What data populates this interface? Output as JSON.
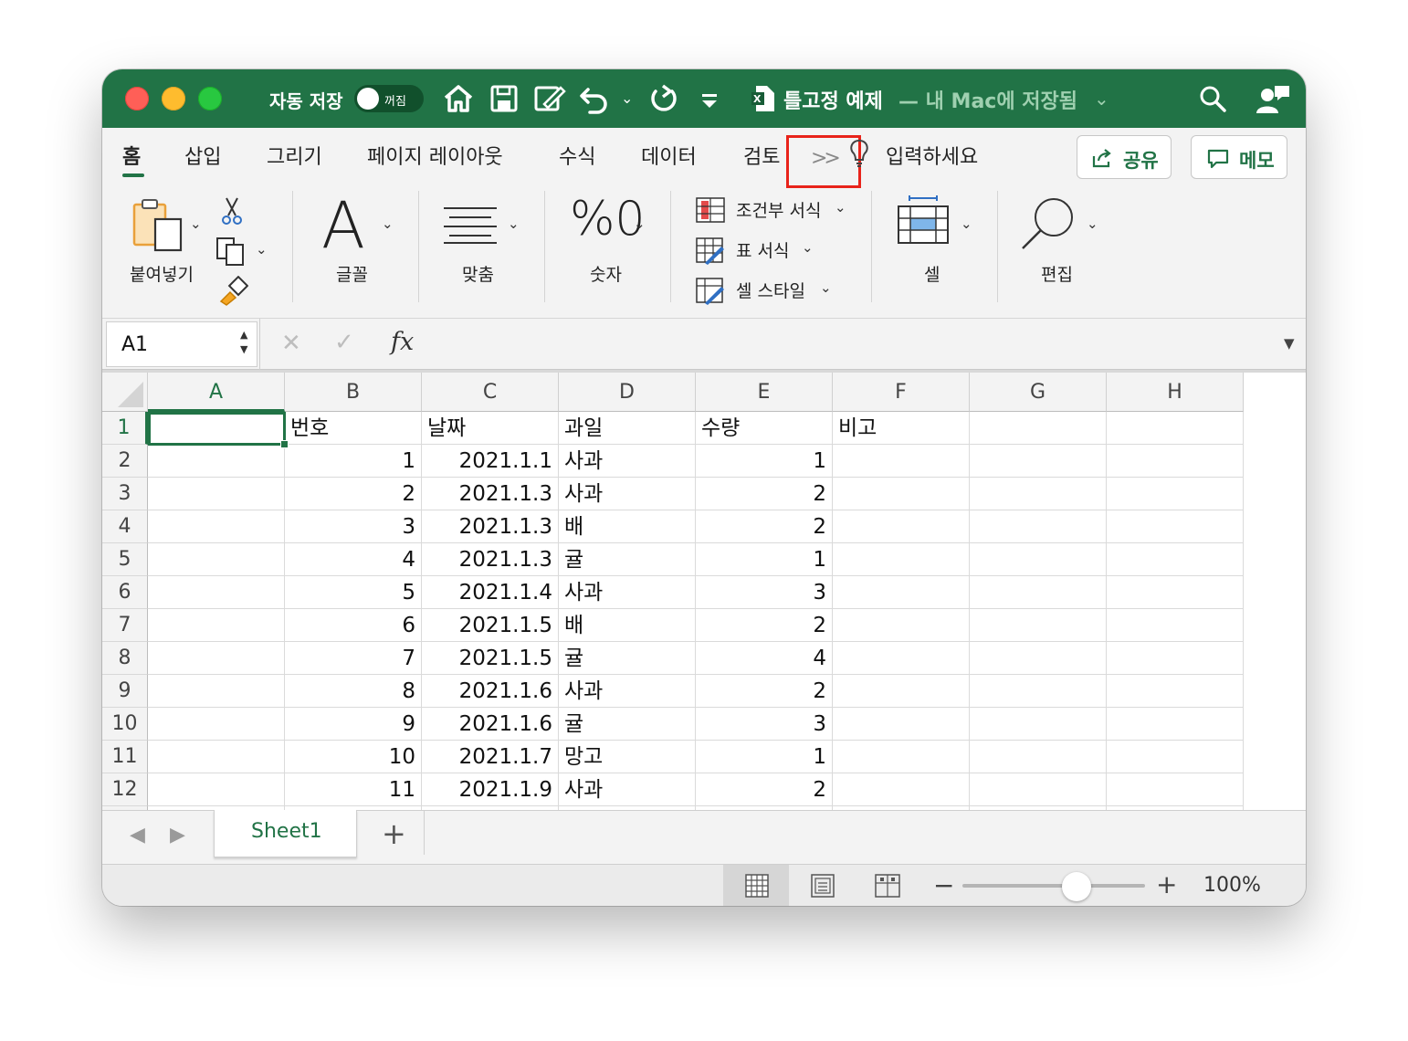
{
  "titlebar": {
    "autosave_label": "자동 저장",
    "autosave_state": "꺼짐",
    "doc_title": "틀고정 예제",
    "doc_location": "— 내 Mac에 저장됨",
    "icons": [
      "home-icon",
      "save-icon",
      "edit-save-icon",
      "undo-icon",
      "redo-icon",
      "customize-icon",
      "excel-doc-icon",
      "search-icon",
      "share-person-icon"
    ]
  },
  "tabs": {
    "items": [
      "홈",
      "삽입",
      "그리기",
      "페이지 레이아웃",
      "수식",
      "데이터",
      "검토"
    ],
    "active": "홈",
    "overflow_label": ">>",
    "tell_me": "입력하세요",
    "share_label": "공유",
    "comments_label": "메모"
  },
  "ribbon": {
    "paste": "붙여넣기",
    "font": "글꼴",
    "alignment": "맞춤",
    "number": "숫자",
    "number_icon": "%0",
    "conditional_format": "조건부 서식",
    "table_format": "표 서식",
    "cell_styles": "셀 스타일",
    "cells": "셀",
    "editing": "편집"
  },
  "formula_bar": {
    "name_box": "A1",
    "fx": "fx",
    "formula": ""
  },
  "sheet": {
    "columns": [
      "A",
      "B",
      "C",
      "D",
      "E",
      "F",
      "G",
      "H"
    ],
    "active_column": "A",
    "active_row": "1",
    "rows": [
      {
        "n": "1",
        "A": "",
        "B": "번호",
        "C": "날짜",
        "D": "과일",
        "E": "수량",
        "F": "비고"
      },
      {
        "n": "2",
        "A": "",
        "B": "1",
        "C": "2021.1.1",
        "D": "사과",
        "E": "1",
        "F": ""
      },
      {
        "n": "3",
        "A": "",
        "B": "2",
        "C": "2021.1.3",
        "D": "사과",
        "E": "2",
        "F": ""
      },
      {
        "n": "4",
        "A": "",
        "B": "3",
        "C": "2021.1.3",
        "D": "배",
        "E": "2",
        "F": ""
      },
      {
        "n": "5",
        "A": "",
        "B": "4",
        "C": "2021.1.3",
        "D": "귤",
        "E": "1",
        "F": ""
      },
      {
        "n": "6",
        "A": "",
        "B": "5",
        "C": "2021.1.4",
        "D": "사과",
        "E": "3",
        "F": ""
      },
      {
        "n": "7",
        "A": "",
        "B": "6",
        "C": "2021.1.5",
        "D": "배",
        "E": "2",
        "F": ""
      },
      {
        "n": "8",
        "A": "",
        "B": "7",
        "C": "2021.1.5",
        "D": "귤",
        "E": "4",
        "F": ""
      },
      {
        "n": "9",
        "A": "",
        "B": "8",
        "C": "2021.1.6",
        "D": "사과",
        "E": "2",
        "F": ""
      },
      {
        "n": "10",
        "A": "",
        "B": "9",
        "C": "2021.1.6",
        "D": "귤",
        "E": "3",
        "F": ""
      },
      {
        "n": "11",
        "A": "",
        "B": "10",
        "C": "2021.1.7",
        "D": "망고",
        "E": "1",
        "F": ""
      },
      {
        "n": "12",
        "A": "",
        "B": "11",
        "C": "2021.1.9",
        "D": "사과",
        "E": "2",
        "F": ""
      }
    ]
  },
  "sheet_tabs": {
    "tabs": [
      "Sheet1"
    ],
    "add_label": "+"
  },
  "status_bar": {
    "zoom_minus": "−",
    "zoom_plus": "+",
    "zoom": "100%",
    "zoom_level": 1.0,
    "views": [
      "normal-view-icon",
      "page-layout-view-icon",
      "page-break-view-icon"
    ]
  },
  "colors": {
    "accent": "#217346",
    "highlight_box": "#e8231a"
  }
}
